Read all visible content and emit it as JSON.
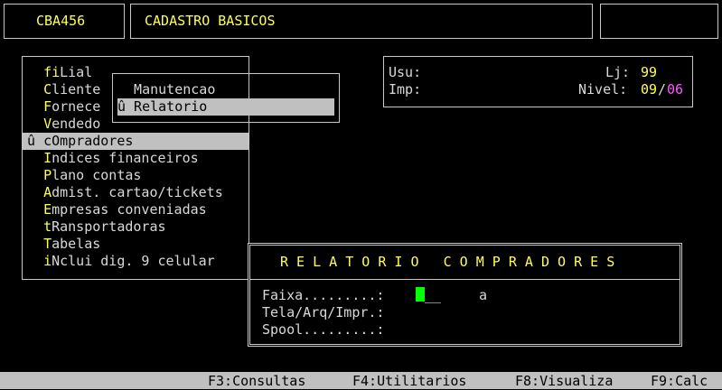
{
  "header": {
    "code": "CBA456",
    "title": "CADASTRO BASICOS"
  },
  "main_menu": {
    "items": [
      {
        "hot": "fi",
        "rest": "Lial"
      },
      {
        "hot": "C",
        "rest": "liente"
      },
      {
        "hot": "F",
        "rest": "ornece"
      },
      {
        "hot": "V",
        "rest": "endedo"
      },
      {
        "prefix": "û ",
        "hot": "c",
        "rest": "Ompradores",
        "selected": true
      },
      {
        "hot": "I",
        "rest": "ndices financeiros"
      },
      {
        "hot": "P",
        "rest": "lano contas"
      },
      {
        "hot": "A",
        "rest": "dmist. cartao/tickets"
      },
      {
        "hot": "E",
        "rest": "mpresas conveniadas"
      },
      {
        "hot": "t",
        "rest": "Ransportadoras"
      },
      {
        "hot": "T",
        "rest": "abelas"
      },
      {
        "hot": "i",
        "rest": "Nclui dig. 9 celular"
      }
    ]
  },
  "submenu": {
    "items": [
      {
        "text": "  Manutencao",
        "selected": false
      },
      {
        "text": "û Relatorio",
        "selected": true
      }
    ]
  },
  "info": {
    "usu_label": "Usu:",
    "lj_label": "Lj: ",
    "lj_value": "99",
    "imp_label": "Imp:",
    "nivel_label": "Nivel: ",
    "nivel_value": "09",
    "nivel_sep": "/",
    "nivel_max": "06"
  },
  "report": {
    "title": "R E L A T O R I O   C O M P R A D O R E S",
    "faixa_label": "Faixa.........:",
    "faixa_value": "__",
    "faixa_to": "a",
    "tela_label": "Tela/Arq/Impr.:",
    "spool_label": "Spool.........:"
  },
  "statusbar": {
    "f3": "F3:Consultas",
    "f4": "F4:Utilitarios",
    "f8": "F8:Visualiza",
    "f9": "F9:Calc"
  }
}
